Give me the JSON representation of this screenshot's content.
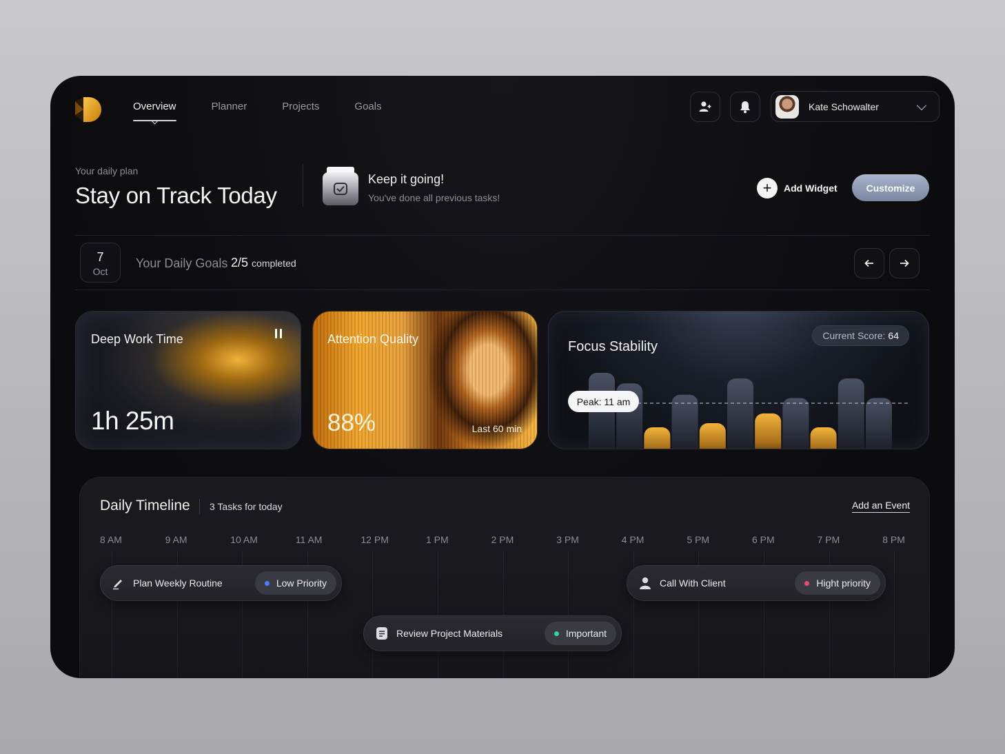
{
  "nav": {
    "items": [
      {
        "label": "Overview",
        "active": true
      },
      {
        "label": "Planner",
        "active": false
      },
      {
        "label": "Projects",
        "active": false
      },
      {
        "label": "Goals",
        "active": false
      }
    ]
  },
  "header": {
    "user_name": "Kate Schowalter",
    "icons": [
      "add-user-icon",
      "bell-icon",
      "chevron-down-icon"
    ]
  },
  "hero": {
    "label": "Your daily plan",
    "title": "Stay on Track Today",
    "status_title": "Keep it going!",
    "status_sub": "You've done all previous tasks!",
    "add_widget": "Add Widget",
    "customize": "Customize"
  },
  "goals": {
    "day": "7",
    "month": "Oct",
    "label": "Your Daily Goals",
    "count": "2/5",
    "count_word": "completed"
  },
  "cards": {
    "deep_work": {
      "title": "Deep Work Time",
      "value": "1h 25m"
    },
    "attention": {
      "title": "Attention Quality",
      "value": "88%",
      "sub": "Last 60 min"
    },
    "focus": {
      "title": "Focus Stability",
      "score_label": "Current Score:",
      "score_value": "64",
      "peak_label": "Peak: 11 am"
    }
  },
  "chart_data": {
    "type": "bar",
    "title": "Focus Stability",
    "series": [
      {
        "values": [
          0.95,
          0.82,
          0.0,
          0.68,
          0.0,
          0.88,
          0.0,
          0.64,
          0.0,
          0.88,
          0.64
        ]
      },
      {
        "values": [
          0.0,
          0.0,
          0.28,
          0.0,
          0.33,
          0.0,
          0.45,
          0.0,
          0.28,
          0.0,
          0.0
        ]
      }
    ],
    "colors": {
      "grey": "#3b4150",
      "gold": "#e6a62e"
    }
  },
  "timeline": {
    "title": "Daily Timeline",
    "count": "3 Tasks for today",
    "add": "Add an Event",
    "hours": [
      "8 AM",
      "9 AM",
      "10 AM",
      "11 AM",
      "12 PM",
      "1 PM",
      "2 PM",
      "3 PM",
      "4 PM",
      "5 PM",
      "6 PM",
      "7 PM",
      "8 PM"
    ],
    "events": [
      {
        "title": "Plan Weekly Routine",
        "priority": "Low Priority",
        "dot": "#4a7dff",
        "icon": "pen-icon"
      },
      {
        "title": "Review Project Materials",
        "priority": "Important",
        "dot": "#2fd3a6",
        "icon": "document-icon"
      },
      {
        "title": "Call With Client",
        "priority": "Hight priority",
        "dot": "#e0506e",
        "icon": "user-icon"
      }
    ]
  }
}
